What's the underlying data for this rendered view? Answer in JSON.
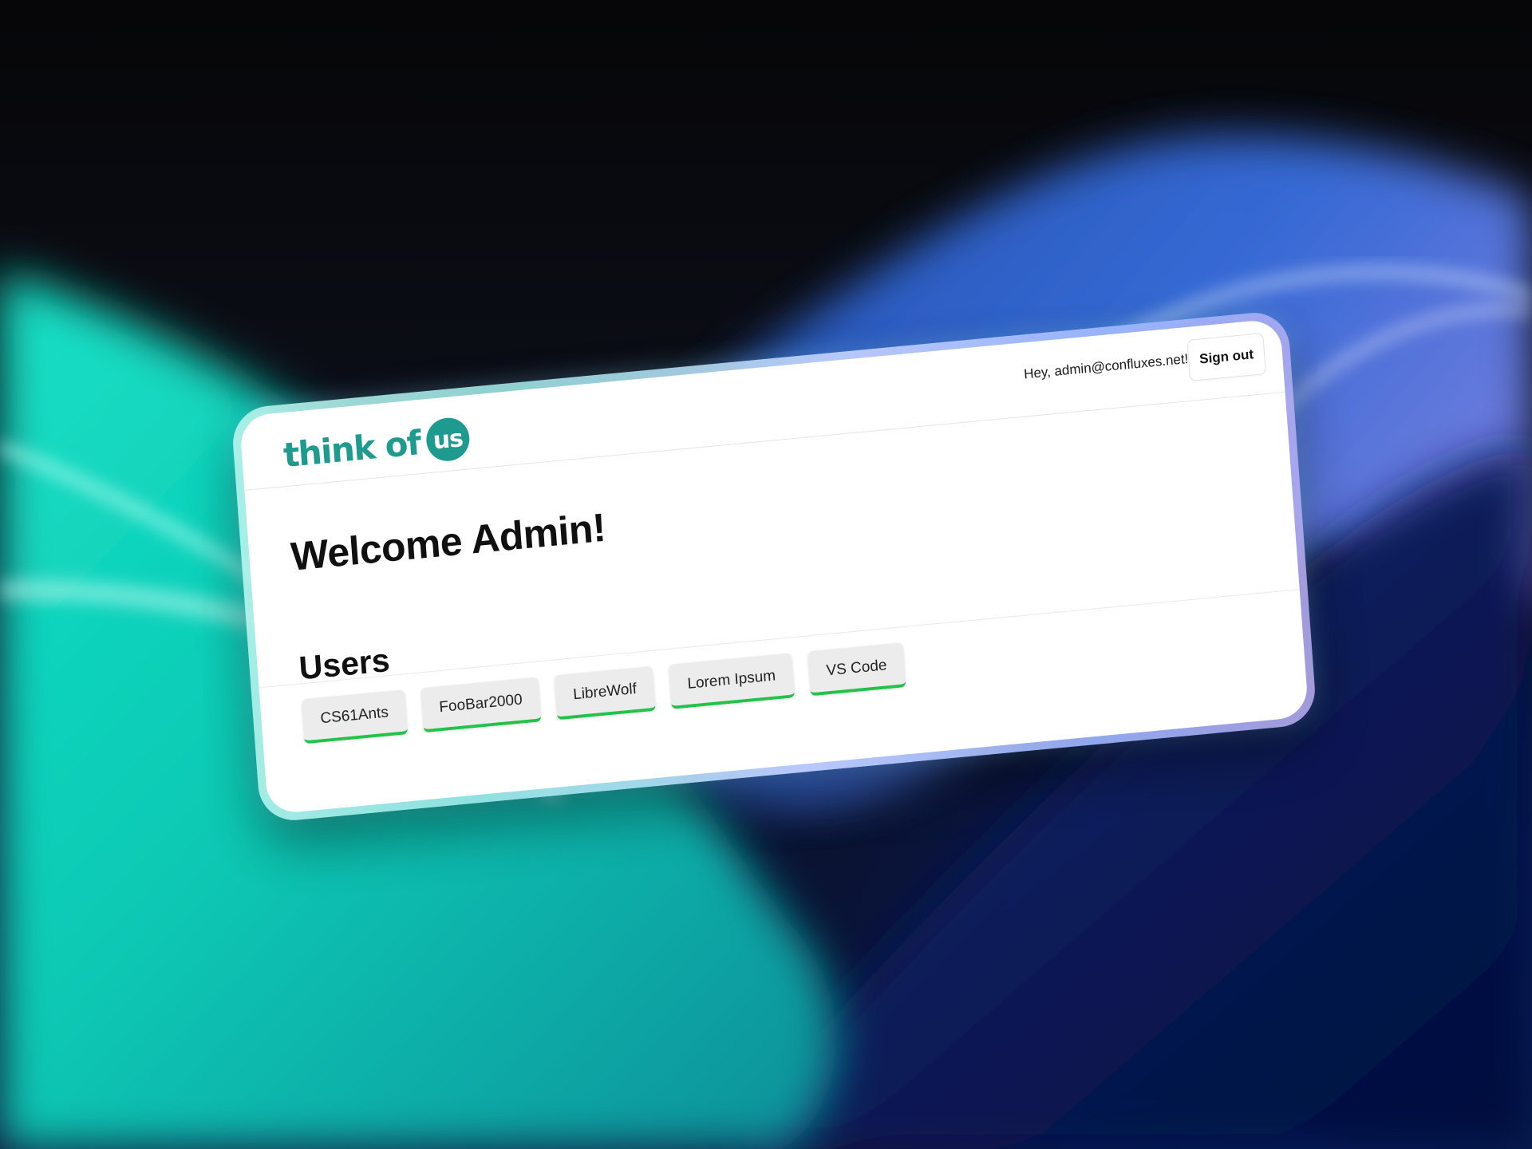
{
  "header": {
    "logo_text": "think of",
    "logo_badge": "us",
    "greeting": "Hey, admin@confluxes.net!",
    "signout_label": "Sign out"
  },
  "main": {
    "welcome": "Welcome Admin!",
    "users_title": "Users",
    "users": [
      {
        "label": "CS61Ants"
      },
      {
        "label": "FooBar2000"
      },
      {
        "label": "LibreWolf"
      },
      {
        "label": "Lorem Ipsum"
      },
      {
        "label": "VS Code"
      }
    ]
  },
  "colors": {
    "brand": "#1f9a8f",
    "chip_accent": "#22c34a",
    "chip_bg": "#ececec"
  }
}
